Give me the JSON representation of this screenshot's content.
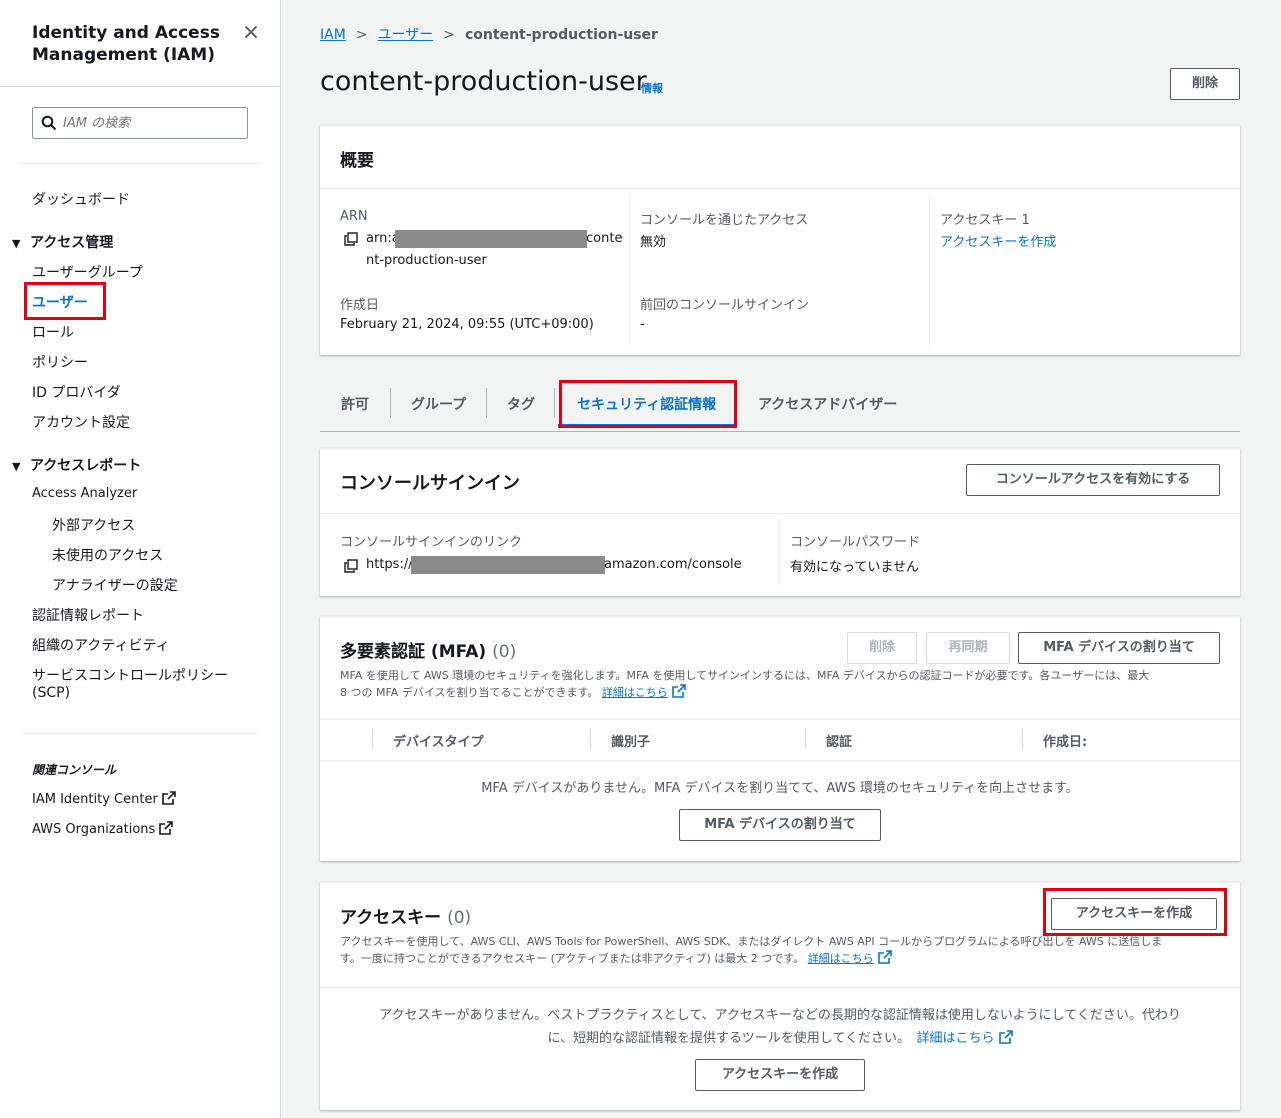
{
  "sidebar": {
    "title": "Identity and Access Management (IAM)",
    "close_icon": "×",
    "search_placeholder": "IAM の検索",
    "dashboard": "ダッシュボード",
    "access_mgmt": "アクセス管理",
    "user_groups": "ユーザーグループ",
    "users": "ユーザー",
    "roles": "ロール",
    "policies": "ポリシー",
    "id_providers": "ID プロバイダ",
    "account_settings": "アカウント設定",
    "access_reports": "アクセスレポート",
    "access_analyzer": "Access Analyzer",
    "external_access": "外部アクセス",
    "unused_access": "未使用のアクセス",
    "analyzer_settings": "アナライザーの設定",
    "cred_report": "認証情報レポート",
    "org_activity": "組織のアクティビティ",
    "scp_line1": "サービスコントロールポリシー",
    "scp_line2": "(SCP)",
    "related": "関連コンソール",
    "identity_center": "IAM Identity Center",
    "organizations": "AWS Organizations"
  },
  "breadcrumb": {
    "iam": "IAM",
    "users": "ユーザー",
    "current": "content-production-user"
  },
  "header": {
    "title": "content-production-user",
    "info": "情報",
    "delete": "削除"
  },
  "summary": {
    "title": "概要",
    "arn_label": "ARN",
    "arn_prefix": "arn:a",
    "arn_suffix": "conte",
    "arn_line2": "nt-production-user",
    "created_label": "作成日",
    "created_value": "February 21, 2024, 09:55 (UTC+09:00)",
    "console_access_label": "コンソールを通じたアクセス",
    "console_access_value": "無効",
    "last_signin_label": "前回のコンソールサインイン",
    "last_signin_value": "-",
    "access_key_label": "アクセスキー 1",
    "create_access_key_link": "アクセスキーを作成"
  },
  "tabs": [
    "許可",
    "グループ",
    "タグ",
    "セキュリティ認証情報",
    "アクセスアドバイザー"
  ],
  "console_signin": {
    "title": "コンソールサインイン",
    "enable_button": "コンソールアクセスを有効にする",
    "link_label": "コンソールサインインのリンク",
    "link_prefix": "https://",
    "link_suffix": "amazon.com/console",
    "password_label": "コンソールパスワード",
    "password_value": "有効になっていません"
  },
  "mfa": {
    "title": "多要素認証 (MFA)",
    "count": "(0)",
    "delete_button": "削除",
    "resync_button": "再同期",
    "assign_button": "MFA デバイスの割り当て",
    "desc_line1": "MFA を使用して AWS 環境のセキュリティを強化します。MFA を使用してサインインするには、MFA デバイスからの認証コードが必要です。各ユーザーには、最大",
    "desc_line2": "8 つの MFA デバイスを割り当てることができます。",
    "learn_more": "詳細はこちら",
    "columns": [
      "デバイスタイプ",
      "識別子",
      "認証",
      "作成日:"
    ],
    "empty_text": "MFA デバイスがありません。MFA デバイスを割り当てて、AWS 環境のセキュリティを向上させます。",
    "empty_button": "MFA デバイスの割り当て"
  },
  "access_keys": {
    "title": "アクセスキー",
    "count": "(0)",
    "create_button": "アクセスキーを作成",
    "desc_line1": "アクセスキーを使用して、AWS CLI、AWS Tools for PowerShell、AWS SDK、またはダイレクト AWS API コールからプログラムによる呼び出しを AWS に送信しま",
    "desc_line2": "す。一度に持つことができるアクセスキー (アクティブまたは非アクティブ) は最大 2 つです。",
    "learn_more": "詳細はこちら",
    "empty_line1": "アクセスキーがありません。ベストプラクティスとして、アクセスキーなどの長期的な認証情報は使用しないようにしてください。代わり",
    "empty_line2": "に、短期的な認証情報を提供するツールを使用してください。",
    "empty_learn_more": "詳細はこちら",
    "empty_button": "アクセスキーを作成"
  }
}
